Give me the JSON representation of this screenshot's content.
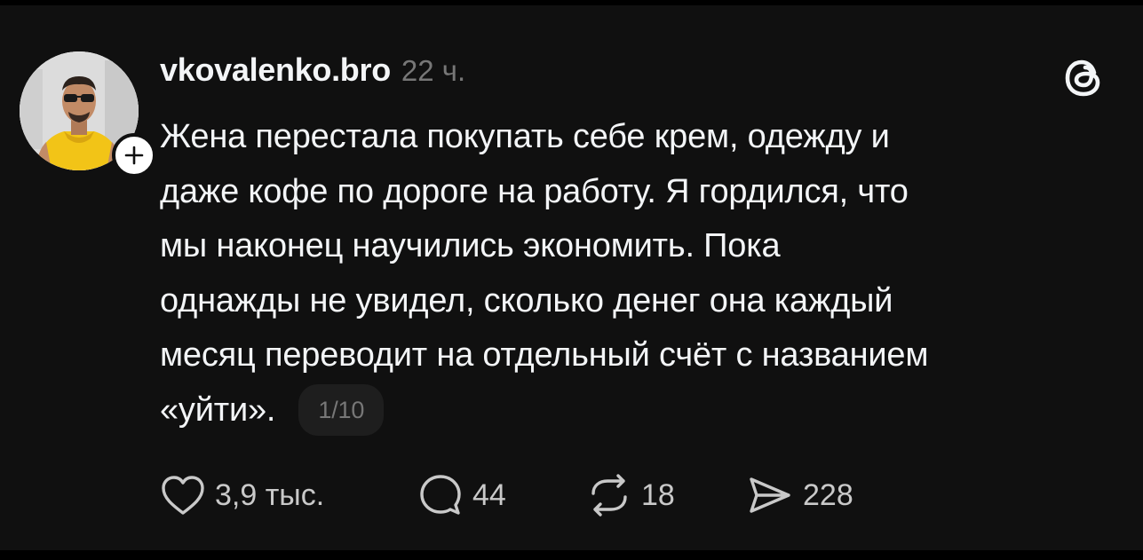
{
  "post": {
    "username": "vkovalenko.bro",
    "time": "22 ч.",
    "text_lines": [
      "Жена перестала покупать себе крем, одежду и",
      "даже кофе по дороге на работу. Я гордился, что",
      "мы наконец научились экономить. Пока",
      "однажды не увидел, сколько денег она каждый",
      "месяц переводит на отдельный счёт с названием",
      "«уйти»."
    ],
    "carousel_counter": "1/10",
    "actions": {
      "likes": "3,9 тыс.",
      "comments": "44",
      "reposts": "18",
      "shares": "228"
    }
  },
  "icons": {
    "logo": "threads-logo-icon",
    "follow": "plus-icon",
    "like": "heart-icon",
    "comment": "comment-bubble-icon",
    "repost": "repost-icon",
    "share": "send-icon"
  },
  "colors": {
    "background": "#101010",
    "text": "#f3f5f7",
    "muted": "#777777"
  }
}
